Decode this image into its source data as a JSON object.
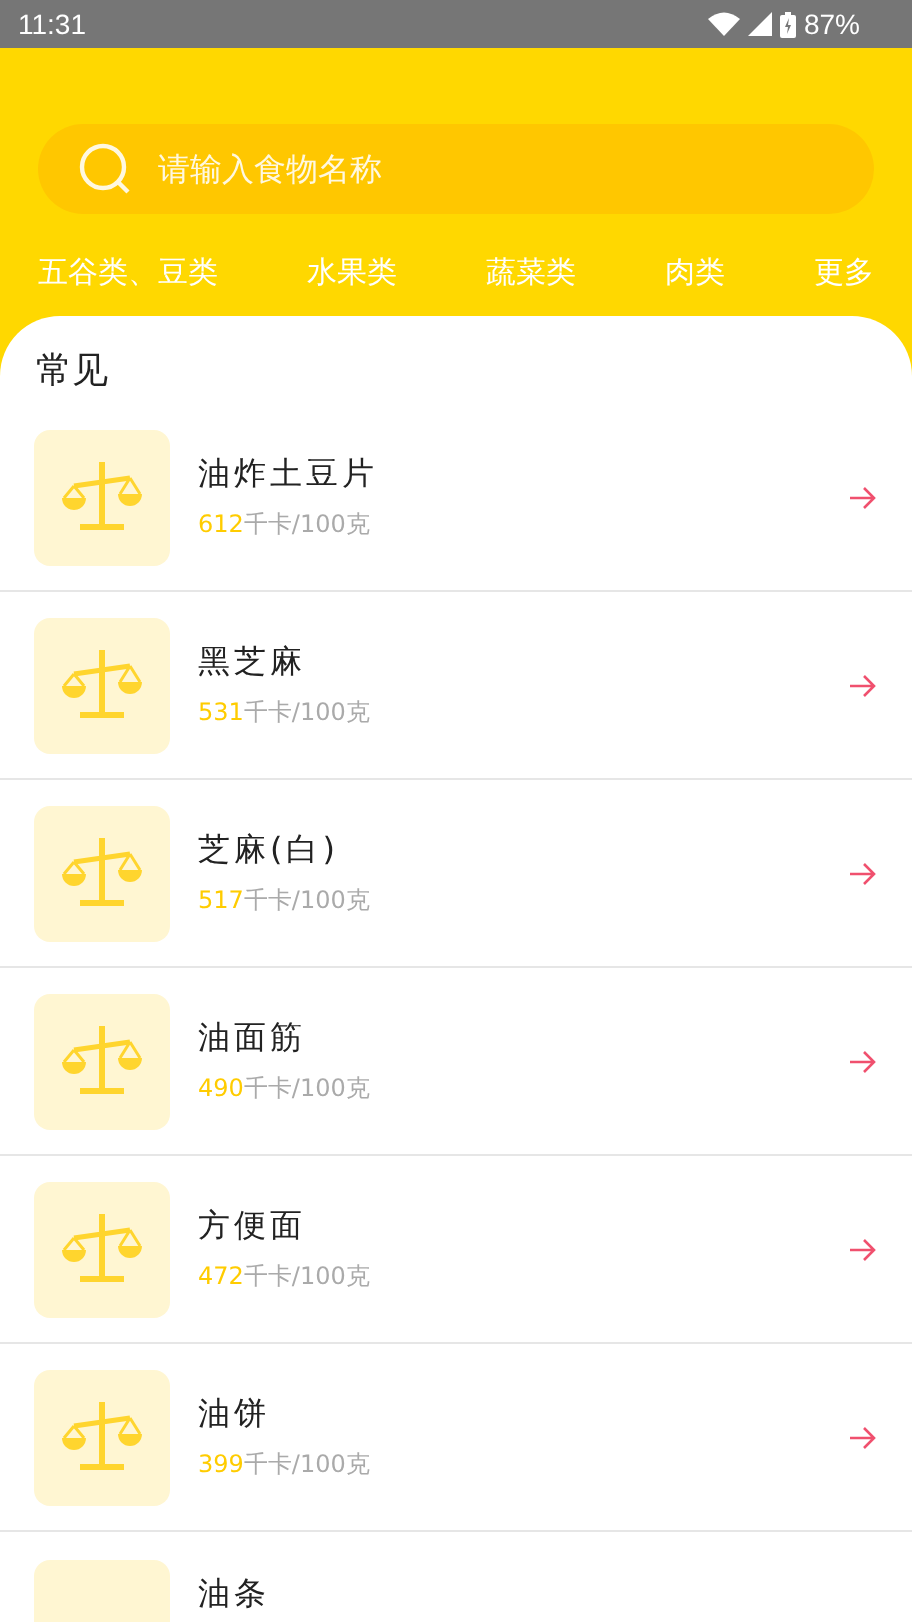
{
  "status_bar": {
    "time": "11:31",
    "battery": "87%"
  },
  "search": {
    "placeholder": "请输入食物名称"
  },
  "categories": [
    "五谷类、豆类",
    "水果类",
    "蔬菜类",
    "肉类",
    "更多"
  ],
  "section": {
    "title": "常见"
  },
  "foods": [
    {
      "name": "油炸土豆片",
      "calories": "612",
      "unit": "千卡/100克"
    },
    {
      "name": "黑芝麻",
      "calories": "531",
      "unit": "千卡/100克"
    },
    {
      "name": "芝麻(白)",
      "calories": "517",
      "unit": "千卡/100克"
    },
    {
      "name": "油面筋",
      "calories": "490",
      "unit": "千卡/100克"
    },
    {
      "name": "方便面",
      "calories": "472",
      "unit": "千卡/100克"
    },
    {
      "name": "油饼",
      "calories": "399",
      "unit": "千卡/100克"
    },
    {
      "name": "油条"
    }
  ]
}
